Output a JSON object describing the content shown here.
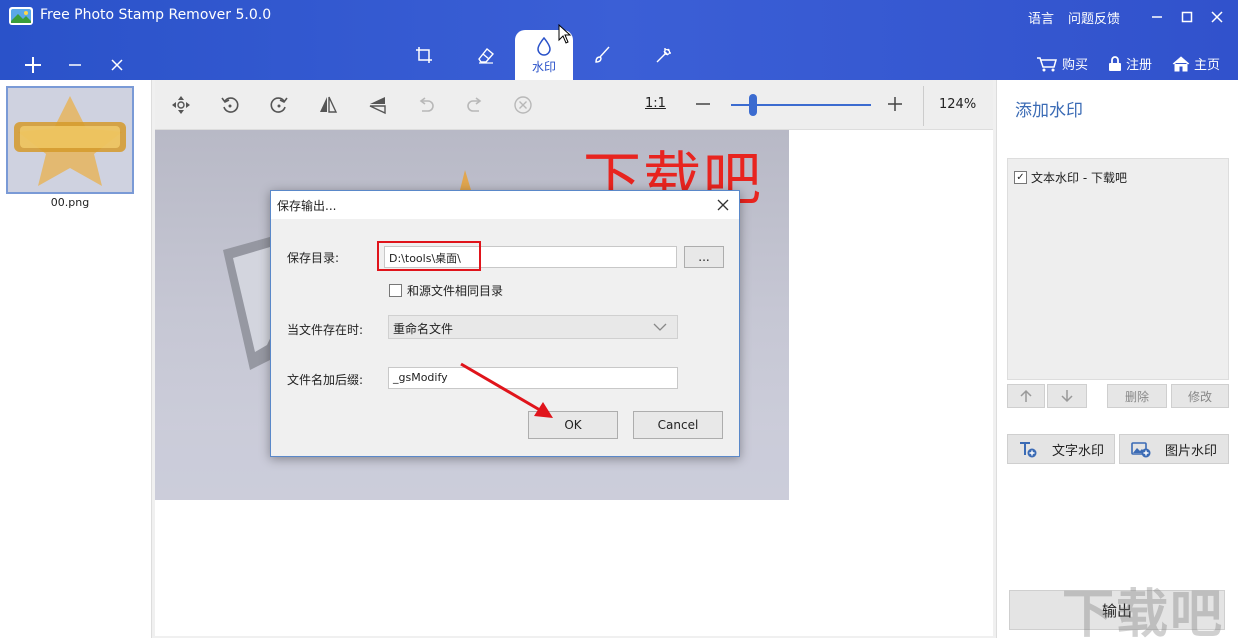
{
  "app": {
    "title": "Free Photo Stamp Remover 5.0.0",
    "header_links": [
      "语言",
      "问题反馈"
    ],
    "left_tools": [
      "add-icon",
      "minus-icon",
      "close-icon"
    ],
    "mode_tabs": [
      {
        "icon": "crop-icon",
        "label": ""
      },
      {
        "icon": "eraser-icon",
        "label": ""
      },
      {
        "icon": "watermark-drop-icon",
        "label": "水印",
        "active": true
      },
      {
        "icon": "brush-icon",
        "label": ""
      },
      {
        "icon": "wand-icon",
        "label": ""
      }
    ],
    "header_actions": {
      "buy": "购买",
      "register": "注册",
      "home": "主页"
    },
    "accent": "#2a52c9"
  },
  "thumbnails": [
    {
      "name": "00.png"
    }
  ],
  "toolbar": {
    "tools": [
      "move-icon",
      "rotate-left-icon",
      "rotate-right-icon",
      "flip-horizontal-icon",
      "flip-vertical-icon",
      "undo-icon",
      "redo-icon",
      "clear-icon"
    ],
    "one_to_one": "1:1",
    "zoom_minus": "—",
    "zoom_plus": "+",
    "zoom": "124%"
  },
  "canvas": {
    "watermark_text": "下载吧"
  },
  "right_panel": {
    "title": "添加水印",
    "watermarks": [
      {
        "label": "文本水印 - 下载吧",
        "checked": true
      }
    ],
    "up_icon": "arrow-up-icon",
    "down_icon": "arrow-down-icon",
    "delete": "删除",
    "modify": "修改",
    "text_watermark": "文字水印",
    "image_watermark": "图片水印",
    "export": "输出"
  },
  "dialog": {
    "title": "保存输出...",
    "save_dir_label": "保存目录:",
    "save_dir_value": "D:\\tools\\桌面\\",
    "browse": "...",
    "same_dir_label": "和源文件相同目录",
    "same_dir_checked": false,
    "exists_label": "当文件存在时:",
    "exists_value": "重命名文件",
    "suffix_label": "文件名加后缀:",
    "suffix_value": "_gsModify",
    "ok": "OK",
    "cancel": "Cancel"
  },
  "site_watermark": "下载吧"
}
